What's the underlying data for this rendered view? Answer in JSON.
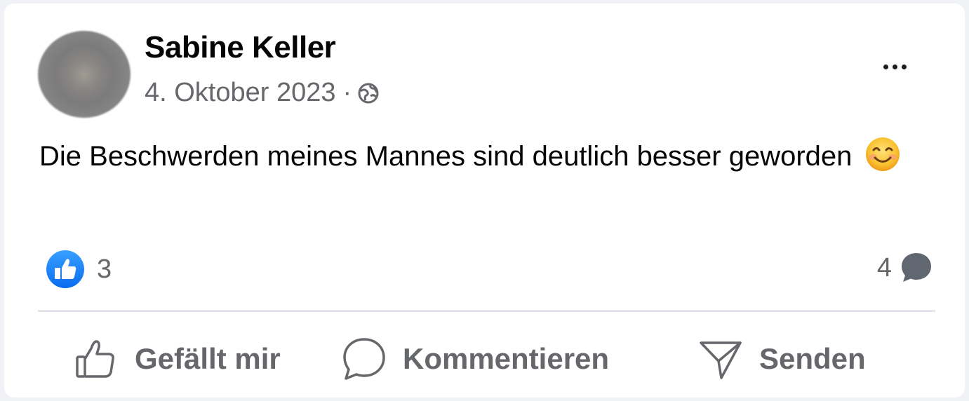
{
  "post": {
    "author": "Sabine Keller",
    "date": "4. Oktober 2023",
    "separator": "·",
    "audience_icon": "public-globe-icon",
    "text": "Die Beschwerden meines Mannes sind deutlich besser geworden",
    "emoji": "smiling-face-icon"
  },
  "stats": {
    "reaction_count": "3",
    "reaction_icon": "like-reaction-icon",
    "comment_count": "4",
    "comment_icon": "comment-bubble-icon"
  },
  "actions": {
    "like_label": "Gefällt mir",
    "comment_label": "Kommentieren",
    "send_label": "Senden"
  },
  "colors": {
    "like_blue": "#1877f2",
    "secondary_text": "#65676b",
    "primary_text": "#050505"
  }
}
